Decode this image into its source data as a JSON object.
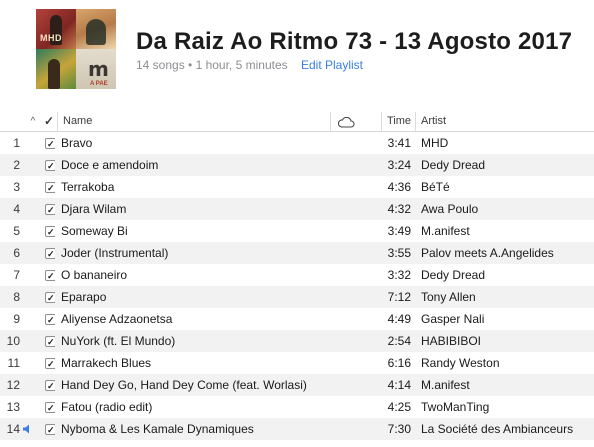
{
  "playlist": {
    "title": "Da Raiz Ao Ritmo 73 - 13 Agosto 2017",
    "meta": "14 songs • 1 hour, 5 minutes",
    "edit_label": "Edit Playlist",
    "artwork_tiles": [
      "MHD",
      "",
      "",
      "m"
    ],
    "artwork_caption": "A PAE"
  },
  "columns": {
    "sort_indicator": "^",
    "check": "✓",
    "name": "Name",
    "cloud_icon": "cloud-icon",
    "time": "Time",
    "artist": "Artist"
  },
  "colors": {
    "accent": "#3a7fe0",
    "row_alt": "#f2f2f2",
    "meta_text": "#8e8e93"
  },
  "now_playing_index": 14,
  "tracks": [
    {
      "num": "1",
      "name": "Bravo",
      "time": "3:41",
      "artist": "MHD",
      "checked": true
    },
    {
      "num": "2",
      "name": "Doce e amendoim",
      "time": "3:24",
      "artist": "Dedy Dread",
      "checked": true
    },
    {
      "num": "3",
      "name": "Terrakoba",
      "time": "4:36",
      "artist": "BéTé",
      "checked": true
    },
    {
      "num": "4",
      "name": "Djara Wilam",
      "time": "4:32",
      "artist": "Awa Poulo",
      "checked": true
    },
    {
      "num": "5",
      "name": "Someway Bi",
      "time": "3:49",
      "artist": "M.anifest",
      "checked": true
    },
    {
      "num": "6",
      "name": "Joder (Instrumental)",
      "time": "3:55",
      "artist": "Palov meets A.Angelides",
      "checked": true
    },
    {
      "num": "7",
      "name": "O bananeiro",
      "time": "3:32",
      "artist": "Dedy Dread",
      "checked": true
    },
    {
      "num": "8",
      "name": "Eparapo",
      "time": "7:12",
      "artist": "Tony Allen",
      "checked": true
    },
    {
      "num": "9",
      "name": "Aliyense Adzaonetsa",
      "time": "4:49",
      "artist": "Gasper Nali",
      "checked": true
    },
    {
      "num": "10",
      "name": "NuYork (ft. El Mundo)",
      "time": "2:54",
      "artist": "HABIBIBOI",
      "checked": true
    },
    {
      "num": "11",
      "name": "Marrakech Blues",
      "time": "6:16",
      "artist": "Randy Weston",
      "checked": true
    },
    {
      "num": "12",
      "name": "Hand Dey Go, Hand Dey Come (feat. Worlasi)",
      "time": "4:14",
      "artist": "M.anifest",
      "checked": true
    },
    {
      "num": "13",
      "name": "Fatou (radio edit)",
      "time": "4:25",
      "artist": "TwoManTing",
      "checked": true
    },
    {
      "num": "14",
      "name": "Nyboma & Les Kamale Dynamiques",
      "time": "7:30",
      "artist": "La Société des Ambianceurs",
      "checked": true
    }
  ]
}
